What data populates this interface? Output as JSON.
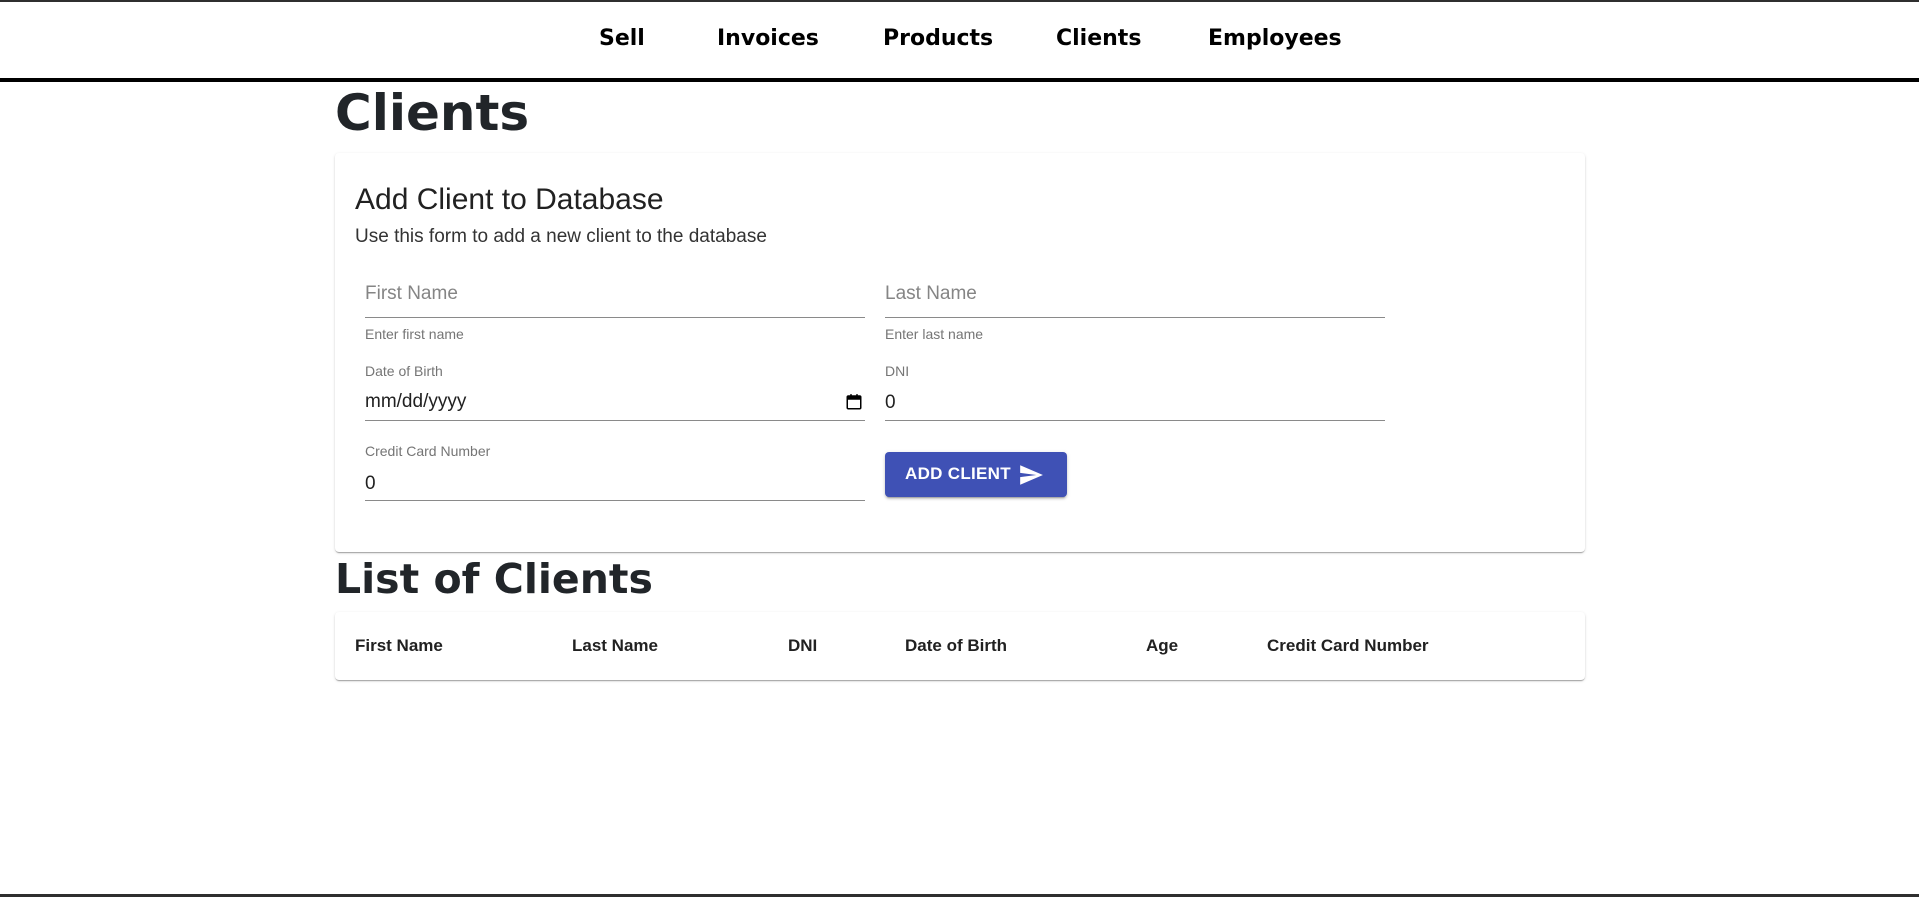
{
  "nav": {
    "items": [
      {
        "label": "Sell"
      },
      {
        "label": "Invoices"
      },
      {
        "label": "Products"
      },
      {
        "label": "Clients"
      },
      {
        "label": "Employees"
      }
    ]
  },
  "page": {
    "title": "Clients"
  },
  "form": {
    "title": "Add Client to Database",
    "subtitle": "Use this form to add a new client to the database",
    "first_name": {
      "placeholder": "First Name",
      "helper": "Enter first name"
    },
    "last_name": {
      "placeholder": "Last Name",
      "helper": "Enter last name"
    },
    "dob": {
      "label": "Date of Birth",
      "value": "mm/dd/yyyy"
    },
    "dni": {
      "label": "DNI",
      "value": "0"
    },
    "credit_card": {
      "label": "Credit Card Number",
      "value": "0"
    },
    "submit_label": "ADD CLIENT"
  },
  "list": {
    "title": "List of Clients",
    "columns": [
      "First Name",
      "Last Name",
      "DNI",
      "Date of Birth",
      "Age",
      "Credit Card Number"
    ]
  },
  "colors": {
    "accent": "#3f51b5",
    "nav_border": "#000000"
  },
  "icons": {
    "date_picker": "calendar-icon",
    "submit": "send-icon"
  }
}
